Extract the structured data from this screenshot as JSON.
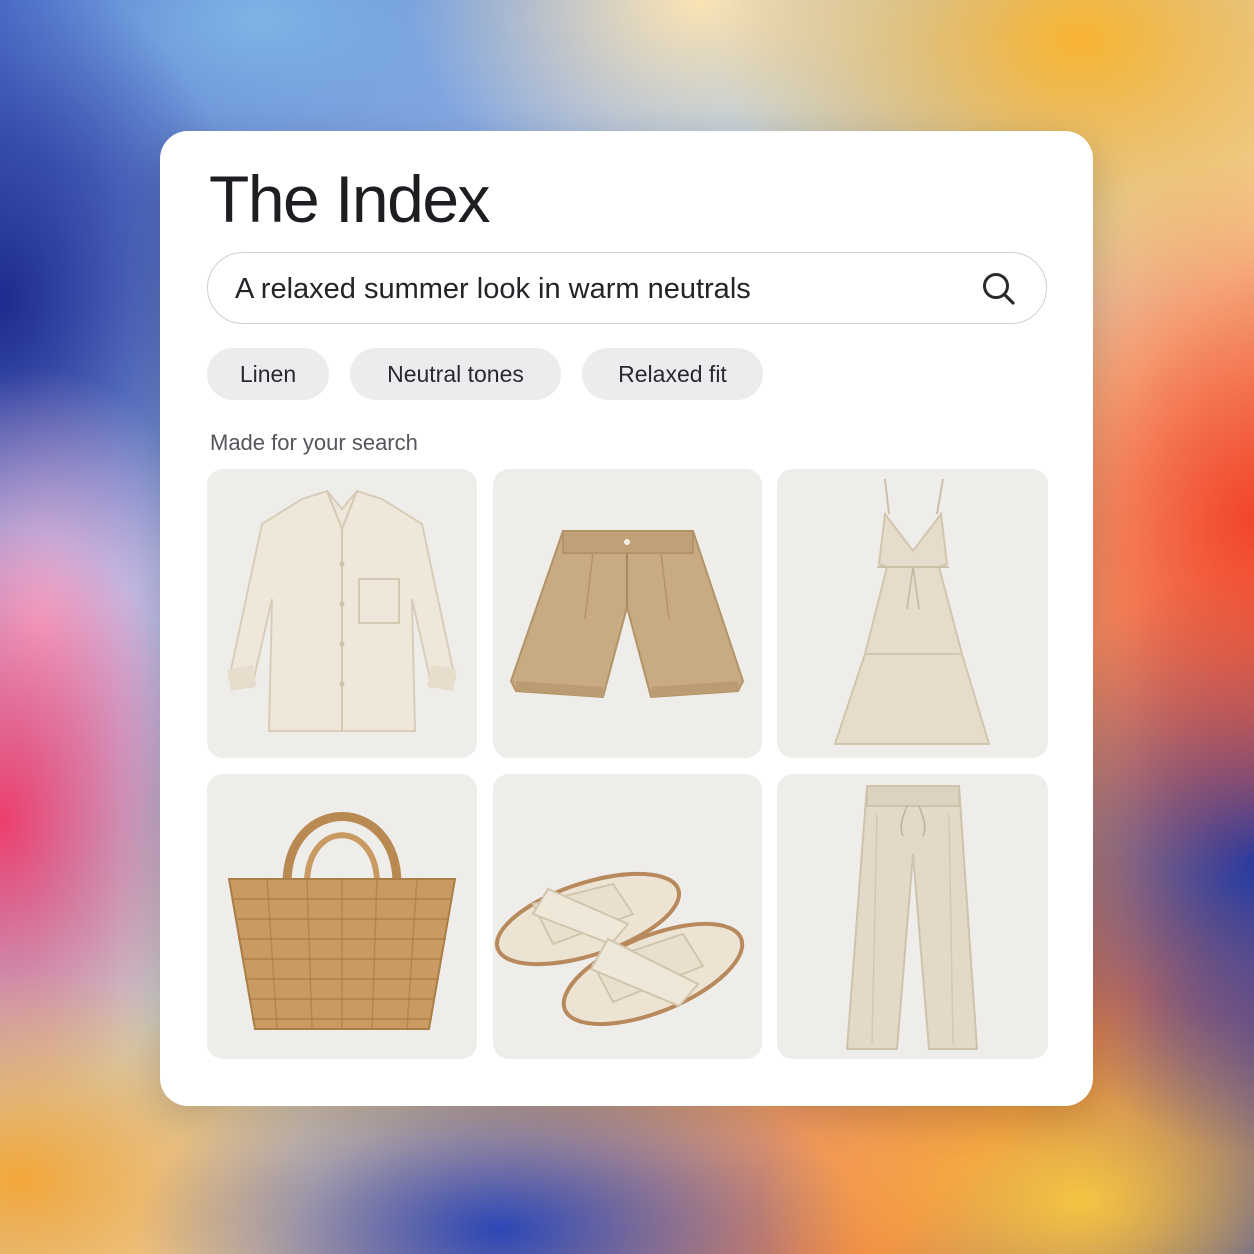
{
  "app": {
    "title": "The Index"
  },
  "search": {
    "query": "A relaxed summer look in warm neutrals",
    "icon": "search-icon"
  },
  "filters": [
    {
      "label": "Linen"
    },
    {
      "label": "Neutral tones"
    },
    {
      "label": "Relaxed fit"
    }
  ],
  "results": {
    "heading": "Made for your search",
    "items": [
      {
        "icon": "linen-shirt-icon",
        "color": "#eee7da"
      },
      {
        "icon": "shorts-icon",
        "color": "#c9ab83"
      },
      {
        "icon": "dress-icon",
        "color": "#e6dccb"
      },
      {
        "icon": "woven-tote-icon",
        "color": "#c99a61"
      },
      {
        "icon": "slide-sandals-icon",
        "color": "#ece3d2"
      },
      {
        "icon": "trousers-icon",
        "color": "#e3d9c8"
      }
    ]
  },
  "colors": {
    "card_background": "#ffffff",
    "tile_background": "#efedea",
    "chip_background": "#ececee",
    "text_primary": "#1d1d22"
  }
}
